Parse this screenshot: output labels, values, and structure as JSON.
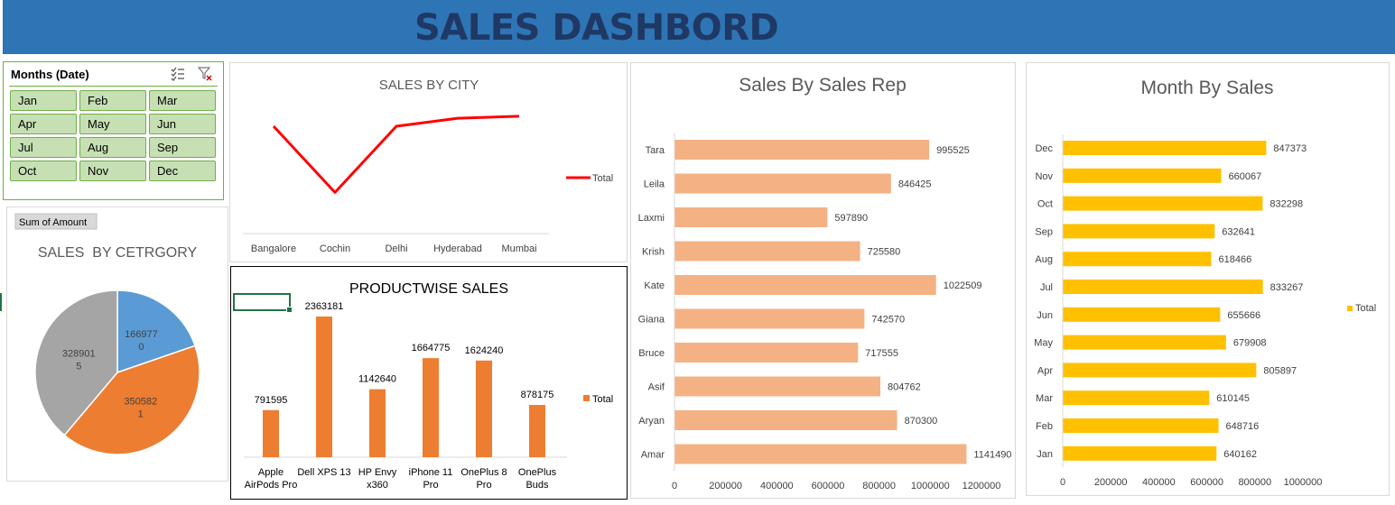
{
  "dashboard": {
    "title": "SALES DASHBORD"
  },
  "slicer": {
    "title": "Months (Date)",
    "items": [
      "Jan",
      "Feb",
      "Mar",
      "Apr",
      "May",
      "Jun",
      "Jul",
      "Aug",
      "Sep",
      "Oct",
      "Nov",
      "Dec"
    ],
    "icons": [
      "multi-select-icon",
      "clear-filter-icon"
    ]
  },
  "pivot_field_button": "Sum of Amount",
  "colors": {
    "banner": "#2e75b6",
    "title": "#1f3864",
    "line": "#ff0000",
    "pie_blue": "#5b9bd5",
    "pie_orange": "#ed7d31",
    "pie_gray": "#a5a5a5",
    "product_bar": "#ed7d31",
    "rep_bar": "#f4b183",
    "month_bar": "#ffc000",
    "slicer_fill": "#c6e0b4",
    "slicer_border": "#70ad47"
  },
  "chart_data": [
    {
      "id": "category",
      "type": "pie",
      "title": "SALES  BY CETRGORY",
      "slices": [
        {
          "label_line1": "166977",
          "label_line2": "0",
          "value": 1669770
        },
        {
          "label_line1": "350582",
          "label_line2": "1",
          "value": 3505821
        },
        {
          "label_line1": "328901",
          "label_line2": "5",
          "value": 3289015
        }
      ]
    },
    {
      "id": "city",
      "type": "line",
      "title": "SALES BY CITY",
      "categories": [
        "Bangalore",
        "Cochin",
        "Delhi",
        "Hyderabad",
        "Mumbai"
      ],
      "series": [
        {
          "name": "Total",
          "values": [
            1720000,
            1060000,
            1720000,
            1800000,
            1820000
          ]
        }
      ]
    },
    {
      "id": "product",
      "type": "bar",
      "title": "PRODUCTWISE SALES",
      "categories": [
        [
          "Apple",
          "AirPods Pro"
        ],
        [
          "Dell XPS 13"
        ],
        [
          "HP Envy",
          "x360"
        ],
        [
          "iPhone 11",
          "Pro"
        ],
        [
          "OnePlus 8",
          "Pro"
        ],
        [
          "OnePlus",
          "Buds"
        ]
      ],
      "series": [
        {
          "name": "Total",
          "values": [
            791595,
            2363181,
            1142640,
            1664775,
            1624240,
            878175
          ]
        }
      ],
      "data_labels": [
        "791595",
        "2363181",
        "1142640",
        "1664775",
        "1624240",
        "878175"
      ]
    },
    {
      "id": "rep",
      "type": "bar",
      "orientation": "horizontal",
      "title": "Sales By Sales Rep",
      "categories": [
        "Tara",
        "Leila",
        "Laxmi",
        "Krish",
        "Kate",
        "Giana",
        "Bruce",
        "Asif",
        "Aryan",
        "Amar"
      ],
      "values": [
        995525,
        846425,
        597890,
        725580,
        1022509,
        742570,
        717555,
        804762,
        870300,
        1141490
      ],
      "data_labels": [
        "995525",
        "846425",
        "597890",
        "725580",
        "1022509",
        "742570",
        "717555",
        "804762",
        "870300",
        "1141490"
      ],
      "xlim": [
        0,
        1200000
      ],
      "x_ticks": [
        "0",
        "200000",
        "400000",
        "600000",
        "800000",
        "1000000",
        "1200000"
      ]
    },
    {
      "id": "month",
      "type": "bar",
      "orientation": "horizontal",
      "title": "Month By Sales",
      "categories": [
        "Dec",
        "Nov",
        "Oct",
        "Sep",
        "Aug",
        "Jul",
        "Jun",
        "May",
        "Apr",
        "Mar",
        "Feb",
        "Jan"
      ],
      "series": [
        {
          "name": "Total",
          "values": [
            847373,
            660067,
            832298,
            632641,
            618466,
            833267,
            655666,
            679908,
            805897,
            610145,
            648716,
            640162
          ]
        }
      ],
      "data_labels": [
        "847373",
        "660067",
        "832298",
        "632641",
        "618466",
        "833267",
        "655666",
        "679908",
        "805897",
        "610145",
        "648716",
        "640162"
      ],
      "xlim": [
        0,
        1000000
      ],
      "x_ticks": [
        "0",
        "200000",
        "400000",
        "600000",
        "800000",
        "1000000"
      ]
    }
  ]
}
